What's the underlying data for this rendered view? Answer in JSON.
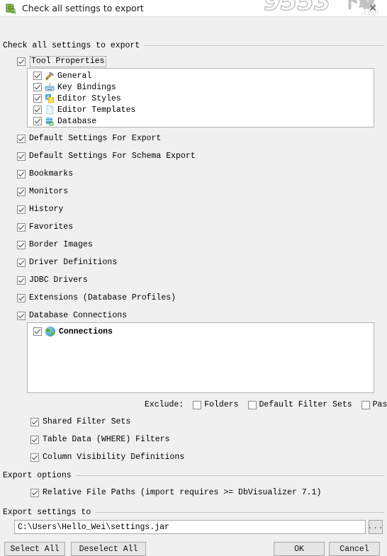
{
  "window": {
    "title": "Check all settings to export",
    "icon": "export-settings-icon",
    "close_label": "✕"
  },
  "groups": {
    "main": "Check all settings to export",
    "export_options": "Export options",
    "export_settings_to": "Export settings to"
  },
  "tool_properties": {
    "label": "Tool Properties",
    "checked": true,
    "children": [
      {
        "label": "General",
        "icon": "hammer-wrench-icon",
        "checked": true
      },
      {
        "label": "Key Bindings",
        "icon": "keyboard-icon",
        "checked": true
      },
      {
        "label": "Editor Styles",
        "icon": "letter-a-icon",
        "checked": true
      },
      {
        "label": "Editor Templates",
        "icon": "document-icon",
        "checked": true
      },
      {
        "label": "Database",
        "icon": "database-icon",
        "checked": true
      }
    ]
  },
  "settings_list": [
    {
      "label": "Default Settings For Export",
      "checked": true
    },
    {
      "label": "Default Settings For Schema Export",
      "checked": true
    },
    {
      "label": "Bookmarks",
      "checked": true
    },
    {
      "label": "Monitors",
      "checked": true
    },
    {
      "label": "History",
      "checked": true
    },
    {
      "label": "Favorites",
      "checked": true
    },
    {
      "label": "Border Images",
      "checked": true
    },
    {
      "label": "Driver Definitions",
      "checked": true
    },
    {
      "label": "JDBC Drivers",
      "checked": true
    },
    {
      "label": "Extensions (Database Profiles)",
      "checked": true
    },
    {
      "label": "Database Connections",
      "checked": true
    }
  ],
  "connections": {
    "label": "Connections",
    "icon": "globe-icon",
    "checked": true
  },
  "exclude": {
    "label": "Exclude:",
    "options": [
      {
        "label": "Folders",
        "checked": false
      },
      {
        "label": "Default Filter Sets",
        "checked": false
      },
      {
        "label": "Passwords",
        "checked": false
      }
    ]
  },
  "sub_options": [
    {
      "label": "Shared Filter Sets",
      "checked": true
    },
    {
      "label": "Table Data (WHERE) Filters",
      "checked": true
    },
    {
      "label": "Column Visibility Definitions",
      "checked": true
    }
  ],
  "export_options": {
    "relative_paths": {
      "label": "Relative File Paths (import requires >= DbVisualizer 7.1)",
      "checked": true
    }
  },
  "path": {
    "value": "C:\\Users\\Hello_Wei\\settings.jar",
    "browse_label": "..."
  },
  "buttons": {
    "select_all": "Select All",
    "deselect_all": "Deselect All",
    "ok": "OK",
    "cancel": "Cancel"
  },
  "watermark": {
    "text": "9553",
    "suffix": "下载",
    "domain": ".com"
  }
}
